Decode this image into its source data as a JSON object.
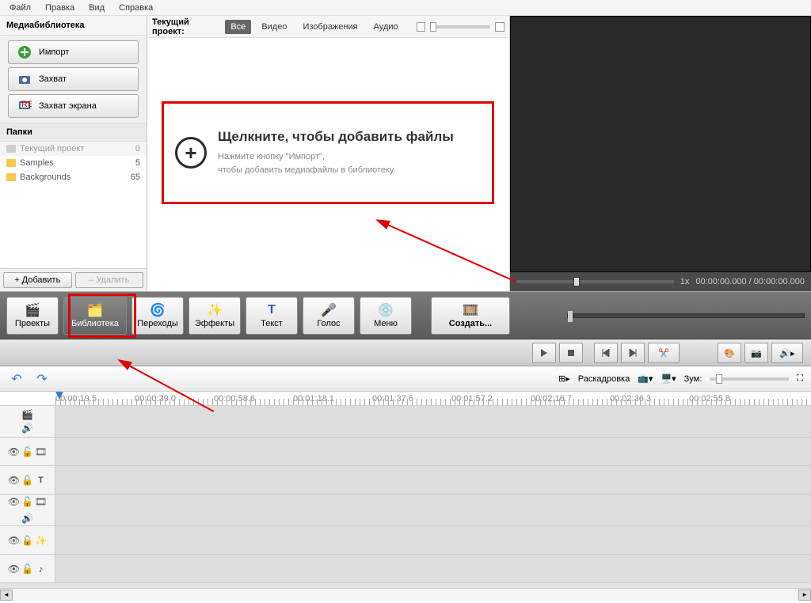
{
  "menu": {
    "file": "Файл",
    "edit": "Правка",
    "view": "Вид",
    "help": "Справка"
  },
  "sidebar": {
    "title": "Медиабиблиотека",
    "import": "Импорт",
    "capture": "Захват",
    "screen_capture": "Захват экрана",
    "folders_title": "Папки",
    "folders": [
      {
        "name": "Текущий проект",
        "count": "0"
      },
      {
        "name": "Samples",
        "count": "5"
      },
      {
        "name": "Backgrounds",
        "count": "65"
      }
    ],
    "add": "+ Добавить",
    "remove": "– Удалить"
  },
  "filter": {
    "label": "Текущий проект:",
    "all": "Все",
    "video": "Видео",
    "images": "Изображения",
    "audio": "Аудио"
  },
  "drop": {
    "title": "Щелкните, чтобы добавить файлы",
    "line1": "Нажмите кнопку \"Импорт\",",
    "line2": "чтобы добавить медиафайлы в библиотеку."
  },
  "preview": {
    "speed": "1x",
    "time": "00:00:00.000 / 00:00:00.000"
  },
  "toolbar": {
    "projects": "Проекты",
    "library": "Библиотека",
    "transitions": "Переходы",
    "effects": "Эффекты",
    "text": "Текст",
    "voice": "Голос",
    "menu": "Меню",
    "create": "Создать..."
  },
  "timeline_header": {
    "storyboard": "Раскадровка",
    "zoom": "Зум:"
  },
  "ruler": [
    "00:00:19.5",
    "00:00:39.0",
    "00:00:58.6",
    "00:01:18.1",
    "00:01:37.6",
    "00:01:57.2",
    "00:02:16.7",
    "00:02:36.3",
    "00:02:55.8"
  ]
}
